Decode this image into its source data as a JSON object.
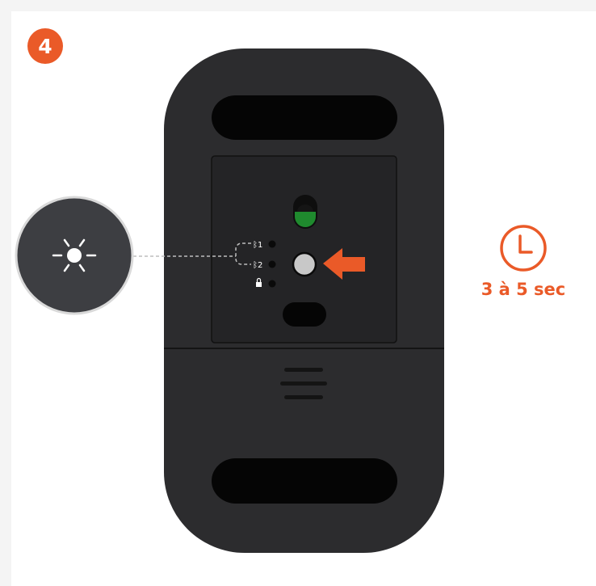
{
  "step": {
    "number": "4",
    "color": "#ea5a28"
  },
  "device": {
    "name": "mouse-underside",
    "body_color": "#2c2c2e",
    "power_switch": {
      "state": "on",
      "indicator_color": "#1f8a2e"
    },
    "channels": [
      {
        "icon": "bluetooth-icon",
        "label": "1"
      },
      {
        "icon": "bluetooth-icon",
        "label": "2"
      },
      {
        "icon": "lock-icon",
        "label": ""
      }
    ],
    "highlighted_channel": "2",
    "button_indicator_icon": "arrow-left-icon"
  },
  "led_callout": {
    "icon": "blinking-light-icon",
    "state": "blinking"
  },
  "timer": {
    "icon": "clock-icon",
    "label": "3 à 5 sec",
    "color": "#ea5a28"
  }
}
